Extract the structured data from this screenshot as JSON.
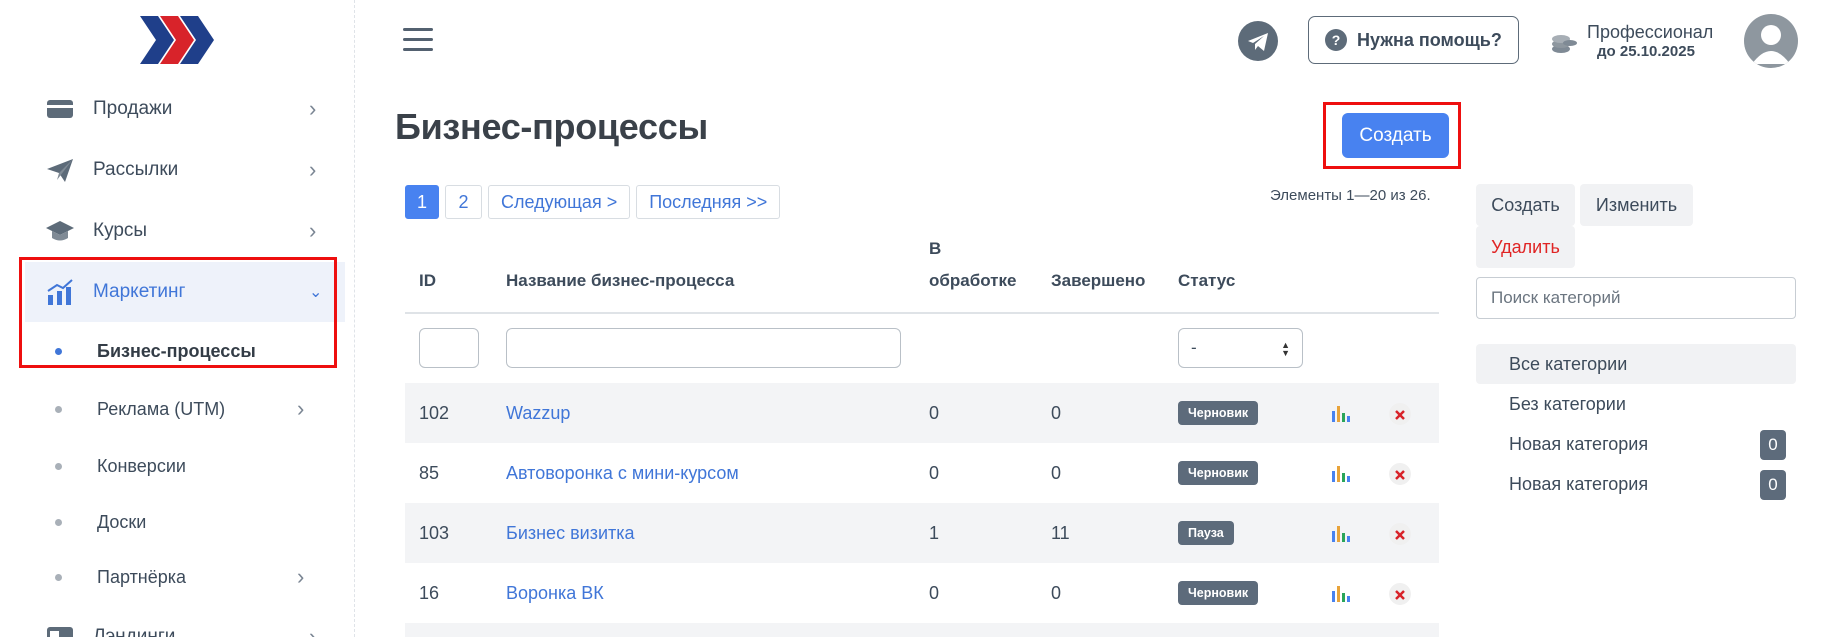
{
  "sidebar": {
    "items": [
      {
        "label": "Продажи",
        "icon": "card-icon"
      },
      {
        "label": "Рассылки",
        "icon": "paper-plane-icon"
      },
      {
        "label": "Курсы",
        "icon": "graduation-cap-icon"
      },
      {
        "label": "Маркетинг",
        "icon": "marketing-chart-icon"
      },
      {
        "label": "Лэндинги",
        "icon": "landing-icon"
      }
    ],
    "subitems": [
      {
        "label": "Бизнес-процессы"
      },
      {
        "label": "Реклама (UTM)"
      },
      {
        "label": "Конверсии"
      },
      {
        "label": "Доски"
      },
      {
        "label": "Партнёрка"
      }
    ]
  },
  "header": {
    "help_label": "Нужна помощь?",
    "help_icon": "?",
    "plan_name": "Профессионал",
    "plan_until": "до 25.10.2025"
  },
  "main": {
    "title": "Бизнес-процессы",
    "create_label": "Создать",
    "pager": [
      "1",
      "2",
      "Следующая >",
      "Последняя >>"
    ],
    "items_info": "Элементы 1—20 из 26.",
    "columns": {
      "id": "ID",
      "name": "Название бизнес-процесса",
      "processing_1": "В",
      "processing_2": "обработке",
      "done": "Завершено",
      "status": "Статус"
    },
    "status_filter": "-",
    "rows": [
      {
        "id": "102",
        "name": "Wazzup",
        "processing": "0",
        "done": "0",
        "status": "Черновик"
      },
      {
        "id": "85",
        "name": "Автоворонка с мини-курсом",
        "processing": "0",
        "done": "0",
        "status": "Черновик"
      },
      {
        "id": "103",
        "name": "Бизнес визитка",
        "processing": "1",
        "done": "11",
        "status": "Пауза"
      },
      {
        "id": "16",
        "name": "Воронка ВК",
        "processing": "0",
        "done": "0",
        "status": "Черновик"
      }
    ]
  },
  "right_panel": {
    "create_label": "Создать",
    "edit_label": "Изменить",
    "delete_label": "Удалить",
    "search_placeholder": "Поиск категорий",
    "categories": [
      {
        "label": "Все категории"
      },
      {
        "label": "Без категории"
      },
      {
        "label": "Новая категория",
        "count": "0"
      },
      {
        "label": "Новая категория",
        "count": "0"
      }
    ]
  },
  "colors": {
    "accent": "#4882f0",
    "highlight": "#ee0f0f",
    "badge": "#5d6b7b"
  }
}
